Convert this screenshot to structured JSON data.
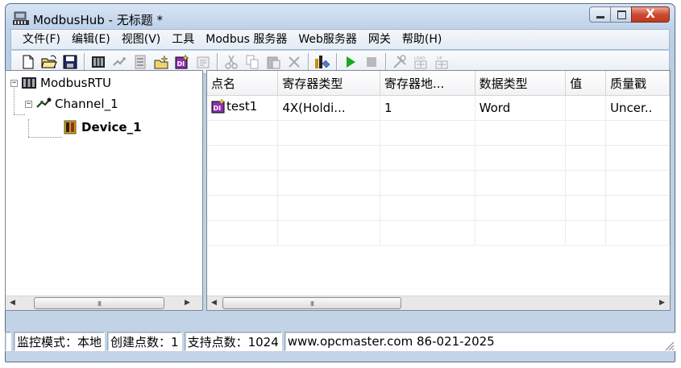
{
  "window": {
    "title": "ModbusHub - 无标题 *",
    "buttons": {
      "minimize": "minimize",
      "maximize": "maximize",
      "close": "X"
    }
  },
  "menu": [
    "文件(F)",
    "编辑(E)",
    "视图(V)",
    "工具",
    "Modbus 服务器",
    "Web服务器",
    "网关",
    "帮助(H)"
  ],
  "toolbar": [
    {
      "icon": "new-file-icon"
    },
    {
      "icon": "open-folder-icon"
    },
    {
      "icon": "save-icon"
    },
    {
      "sep": true
    },
    {
      "icon": "add-channel-icon"
    },
    {
      "icon": "add-device-icon"
    },
    {
      "icon": "device-list-icon"
    },
    {
      "icon": "new-tag-icon"
    },
    {
      "icon": "tag-icon"
    },
    {
      "icon": "properties-icon"
    },
    {
      "sep": true
    },
    {
      "icon": "cut-icon"
    },
    {
      "icon": "copy-icon"
    },
    {
      "icon": "paste-icon"
    },
    {
      "icon": "delete-icon"
    },
    {
      "sep": true
    },
    {
      "icon": "monitor-icon"
    },
    {
      "sep": true
    },
    {
      "icon": "run-icon"
    },
    {
      "icon": "stop-icon"
    },
    {
      "sep": true
    },
    {
      "icon": "tools-icon"
    },
    {
      "icon": "load-icon"
    },
    {
      "icon": "upload-icon"
    }
  ],
  "tree": {
    "root": "ModbusRTU",
    "channel": "Channel_1",
    "device": "Device_1"
  },
  "grid": {
    "columns": [
      "点名",
      "寄存器类型",
      "寄存器地...",
      "数据类型",
      "值",
      "质量戳"
    ],
    "rows": [
      [
        "test1",
        "4X(Holdi...",
        "1",
        "Word",
        "",
        "Uncer.."
      ]
    ],
    "empty_rows": 5
  },
  "status": {
    "pane0": "",
    "mode": "监控模式：本地",
    "created": "创建点数：1",
    "supported": "支持点数：1024",
    "contact": "www.opcmaster.com 86-021-2025"
  },
  "colors": {
    "accent_red": "#cc4a31",
    "tag_icon_purple": "#8e2fb0",
    "run_green": "#1aaa1a"
  }
}
